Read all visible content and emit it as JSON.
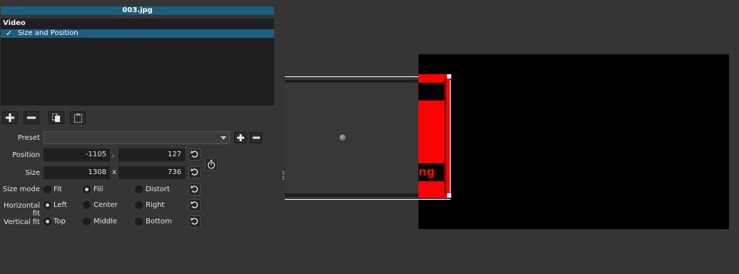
{
  "panel": {
    "title": "003.jpg",
    "group": "Video",
    "filter_check": "✓",
    "filter_name": "Size and Position"
  },
  "toolbar": {
    "add_icon": "plus-icon",
    "remove_icon": "minus-icon",
    "copy_icon": "copy-icon",
    "paste_icon": "paste-icon"
  },
  "form": {
    "preset_label": "Preset",
    "preset_value": "",
    "position_label": "Position",
    "position_x": "-1105",
    "position_sep": ",",
    "position_y": "127",
    "size_label": "Size",
    "size_w": "1308",
    "size_sep": "x",
    "size_h": "736",
    "size_mode_label": "Size mode",
    "size_mode_options": [
      "Fit",
      "Fill",
      "Distort"
    ],
    "size_mode_selected": "Fill",
    "hfit_label": "Horizontal fit",
    "hfit_options": [
      "Left",
      "Center",
      "Right"
    ],
    "hfit_selected": "Left",
    "vfit_label": "Vertical fit",
    "vfit_options": [
      "Top",
      "Middle",
      "Bottom"
    ],
    "vfit_selected": "Top"
  },
  "preview": {
    "overlay_text": "ng",
    "colors": {
      "image_red": "#ff0000",
      "canvas": "#000000",
      "accent": "#1b5f7e"
    }
  }
}
